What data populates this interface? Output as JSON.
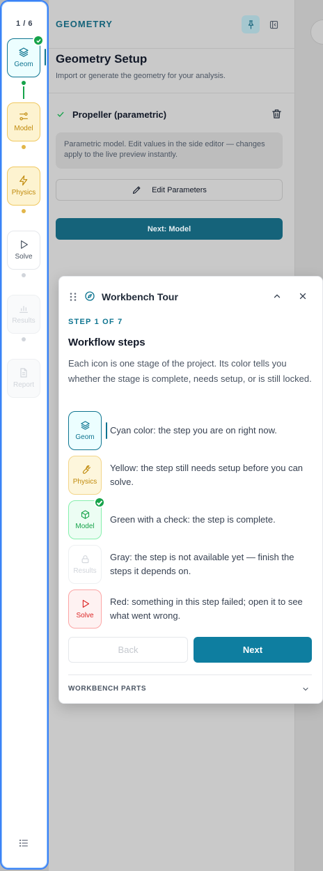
{
  "rail": {
    "counter": "1 / 6",
    "steps": [
      {
        "label": "Geom",
        "icon": "layers-icon",
        "state": "current-complete"
      },
      {
        "label": "Model",
        "icon": "sliders-icon",
        "state": "needs-setup"
      },
      {
        "label": "Physics",
        "icon": "bolt-icon",
        "state": "needs-setup"
      },
      {
        "label": "Solve",
        "icon": "play-icon",
        "state": "available"
      },
      {
        "label": "Results",
        "icon": "bar-chart-icon",
        "state": "locked"
      },
      {
        "label": "Report",
        "icon": "document-icon",
        "state": "locked"
      }
    ],
    "menu_icon": "list-icon"
  },
  "panel": {
    "kicker": "GEOMETRY",
    "title": "Geometry Setup",
    "subtitle": "Import or generate the geometry for your analysis.",
    "item_name": "Propeller (parametric)",
    "item_description": "Parametric model. Edit values in the side editor — changes apply to the live preview instantly.",
    "edit_button": "Edit Parameters",
    "next_button": "Next: Model"
  },
  "tour": {
    "title": "Workbench Tour",
    "step_kicker": "STEP 1 OF 7",
    "heading": "Workflow steps",
    "body": "Each icon is one stage of the project. Its color tells you whether the stage is complete, needs setup, or is still locked.",
    "legend": [
      {
        "tile_label": "Geom",
        "text": "Cyan color: the step you are on right now."
      },
      {
        "tile_label": "Physics",
        "text": "Yellow: the step still needs setup before you can solve."
      },
      {
        "tile_label": "Model",
        "text": "Green with a check: the step is complete."
      },
      {
        "tile_label": "Results",
        "text": "Gray: the step is not available yet — finish the steps it depends on."
      },
      {
        "tile_label": "Solve",
        "text": "Red: something in this step failed; open it to see what went wrong."
      }
    ],
    "back_button": "Back",
    "next_button": "Next",
    "parts_label": "WORKBENCH PARTS"
  },
  "colors": {
    "cyan": "#0e7490",
    "yellow": "#c08a0b",
    "green": "#16a34a",
    "red": "#dc2626",
    "rail_focus_border": "#3b82f6"
  }
}
